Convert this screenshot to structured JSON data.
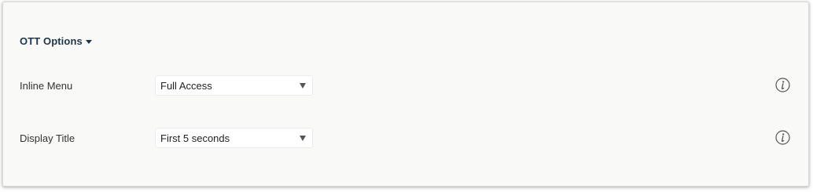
{
  "section": {
    "title": "OTT Options",
    "expand_icon": "caret-down-icon"
  },
  "rows": [
    {
      "label": "Inline Menu",
      "value": "Full Access",
      "dropdown_icon": "triangle-down-icon",
      "info_icon": "info-icon"
    },
    {
      "label": "Display Title",
      "value": "First 5 seconds",
      "dropdown_icon": "triangle-down-icon",
      "info_icon": "info-icon"
    }
  ],
  "colors": {
    "panel_background": "#f9f9f7",
    "title_text": "#1f3548",
    "label_text": "#333333"
  }
}
